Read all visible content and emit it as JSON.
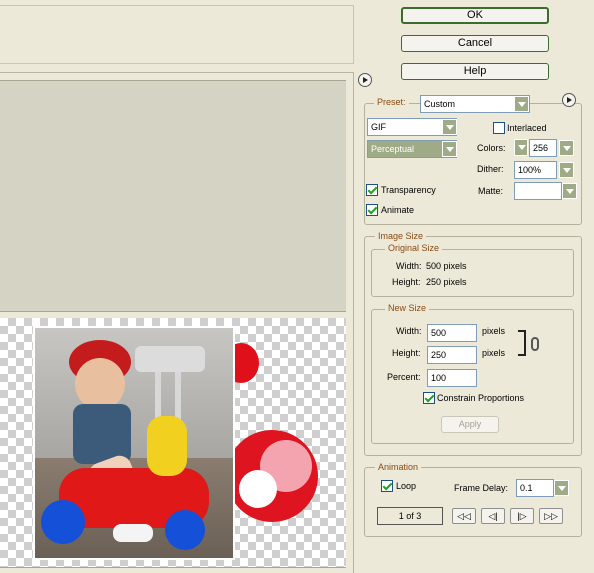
{
  "buttons": {
    "ok": "OK",
    "cancel": "Cancel",
    "help": "Help"
  },
  "preset": {
    "label": "Preset:",
    "value": "Custom"
  },
  "format": {
    "value": "GIF"
  },
  "reduction": {
    "value": "Perceptual"
  },
  "interlaced": {
    "label": "Interlaced",
    "checked": false
  },
  "colors": {
    "label": "Colors:",
    "value": "256"
  },
  "dither": {
    "label": "Dither:",
    "value": "100%"
  },
  "transparency": {
    "label": "Transparency",
    "checked": true
  },
  "matte": {
    "label": "Matte:",
    "value": ""
  },
  "animate": {
    "label": "Animate",
    "checked": true
  },
  "image_size": {
    "title": "Image Size",
    "original": {
      "title": "Original Size",
      "width_label": "Width:",
      "width_value": "500 pixels",
      "height_label": "Height:",
      "height_value": "250 pixels"
    },
    "new": {
      "title": "New Size",
      "width_label": "Width:",
      "width_value": "500",
      "width_unit": "pixels",
      "height_label": "Height:",
      "height_value": "250",
      "height_unit": "pixels",
      "percent_label": "Percent:",
      "percent_value": "100",
      "constrain_label": "Constrain Proportions",
      "constrain_checked": true,
      "apply_label": "Apply"
    }
  },
  "animation": {
    "title": "Animation",
    "loop_label": "Loop",
    "loop_checked": true,
    "frame_delay_label": "Frame Delay:",
    "frame_delay_value": "0.1",
    "frame_counter": "1 of 3",
    "controls": {
      "first": "◁◁",
      "prev": "◁|",
      "next": "|▷",
      "last": "▷▷"
    }
  },
  "colors_theme": {
    "accent_green": "#3c6d2e",
    "label_brown": "#8b4a10",
    "red_graphic": "#e0101a"
  }
}
